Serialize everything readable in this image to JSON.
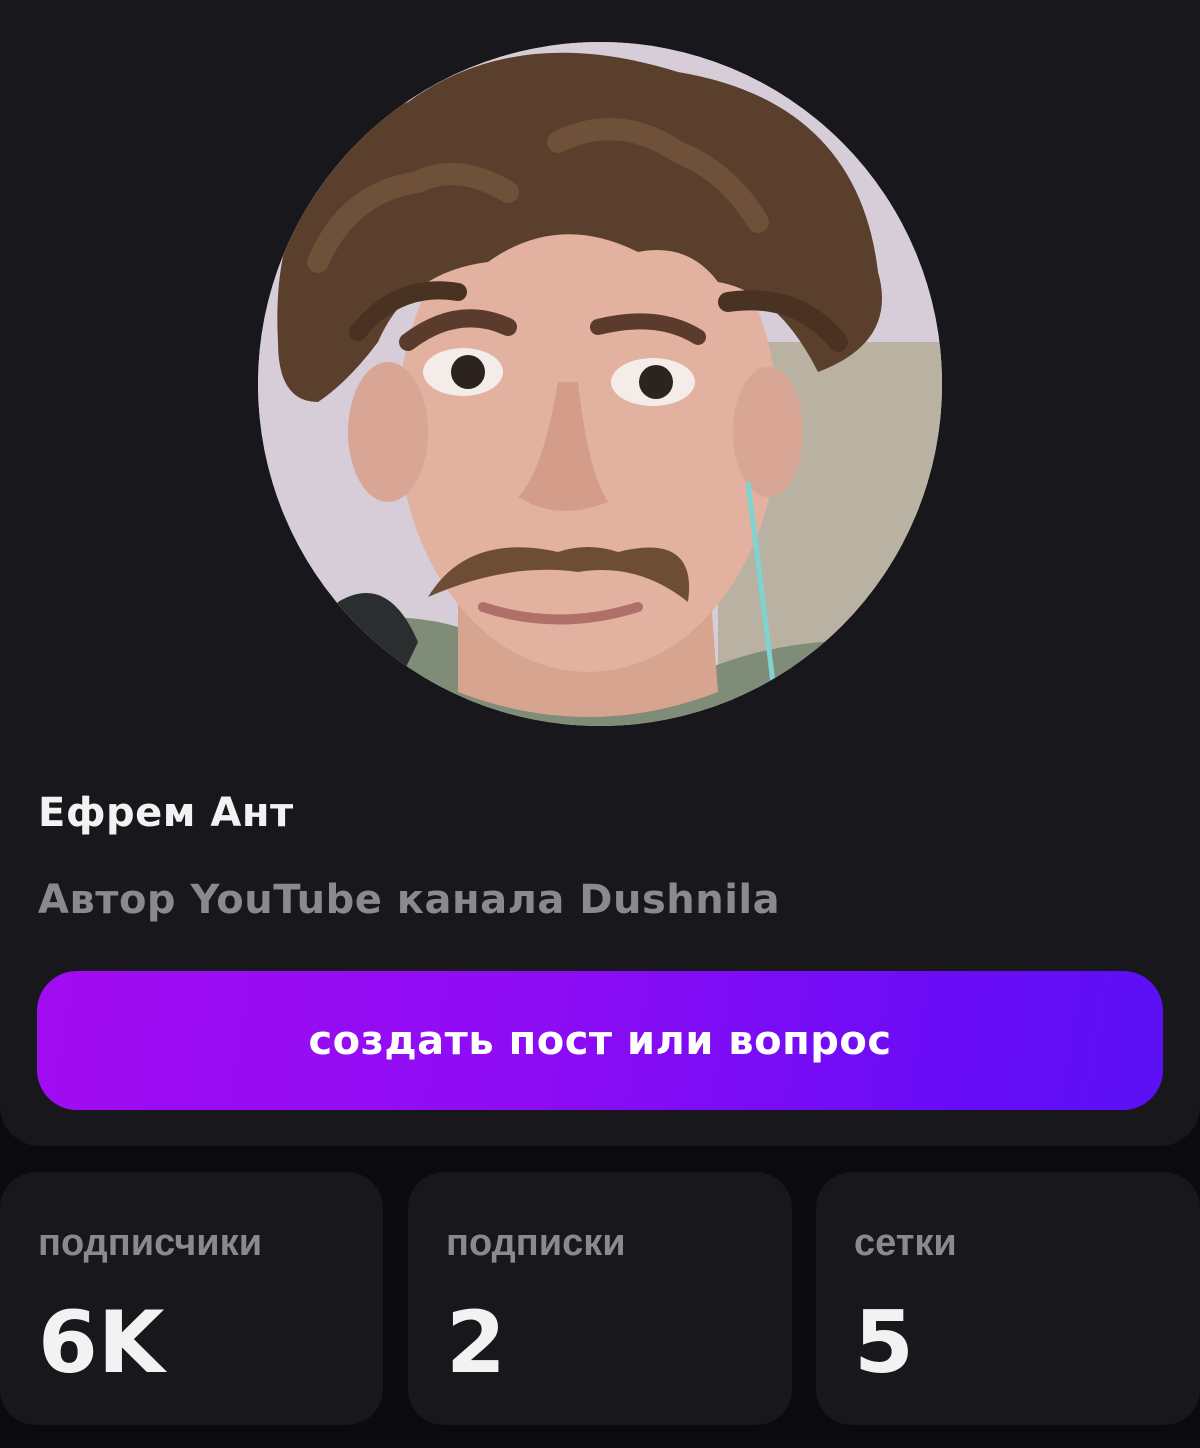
{
  "profile": {
    "avatar_alt": "avatar",
    "name": "Ефрем Ант",
    "bio": "Автор YouTube канала Dushnila",
    "cta_label": "создать пост или вопрос"
  },
  "stats": [
    {
      "label": "подписчики",
      "value": "6K"
    },
    {
      "label": "подписки",
      "value": "2"
    },
    {
      "label": "сетки",
      "value": "5"
    }
  ],
  "colors": {
    "background": "#0b0b0e",
    "card": "#18181c",
    "accent_start": "#a20cf2",
    "accent_end": "#5a10f5",
    "text_primary": "#f2f2f2",
    "text_secondary": "#8a8a8e"
  }
}
